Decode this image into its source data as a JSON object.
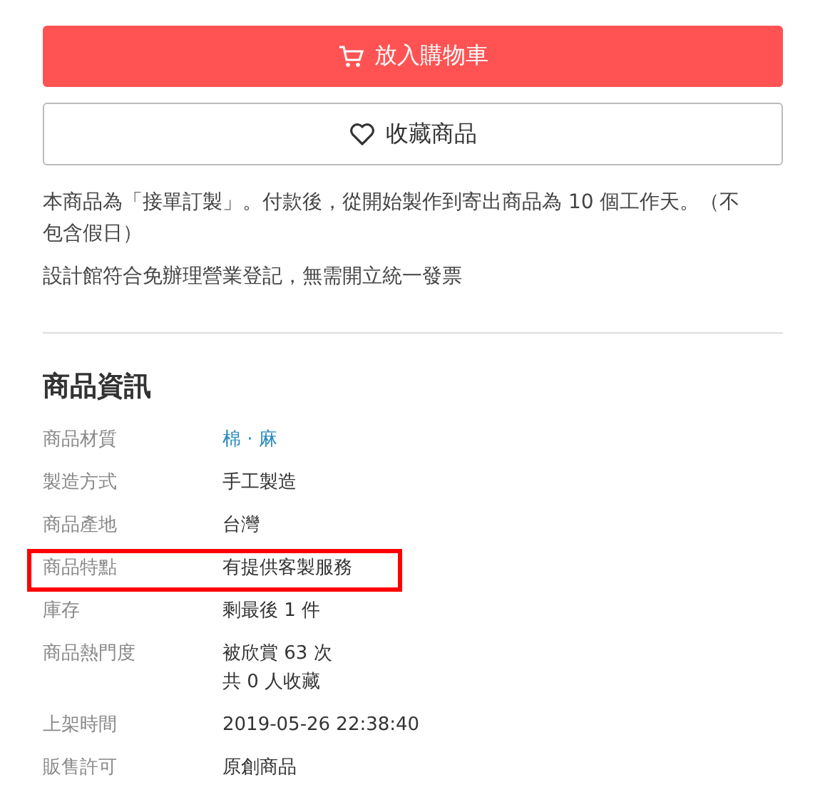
{
  "cart_button": {
    "label": "放入購物車"
  },
  "favorite_button": {
    "label": "收藏商品"
  },
  "notes": [
    "本商品為「接單訂製」。付款後，從開始製作到寄出商品為 10 個工作天。（不包含假日）",
    "設計館符合免辦理營業登記，無需開立統一發票"
  ],
  "info": {
    "title": "商品資訊",
    "rows": [
      {
        "label": "商品材質",
        "kind": "link",
        "values": [
          "棉 · 麻"
        ],
        "highlighted": false
      },
      {
        "label": "製造方式",
        "kind": "text",
        "values": [
          "手工製造"
        ],
        "highlighted": false
      },
      {
        "label": "商品產地",
        "kind": "text",
        "values": [
          "台灣"
        ],
        "highlighted": false
      },
      {
        "label": "商品特點",
        "kind": "text",
        "values": [
          "有提供客製服務"
        ],
        "highlighted": true
      },
      {
        "label": "庫存",
        "kind": "text",
        "values": [
          "剩最後 1 件"
        ],
        "highlighted": false
      },
      {
        "label": "商品熱門度",
        "kind": "text",
        "values": [
          "被欣賞 63 次",
          "共 0 人收藏"
        ],
        "highlighted": false
      },
      {
        "label": "上架時間",
        "kind": "text",
        "values": [
          "2019-05-26 22:38:40"
        ],
        "highlighted": false
      },
      {
        "label": "販售許可",
        "kind": "text",
        "values": [
          "原創商品"
        ],
        "highlighted": false
      }
    ]
  }
}
